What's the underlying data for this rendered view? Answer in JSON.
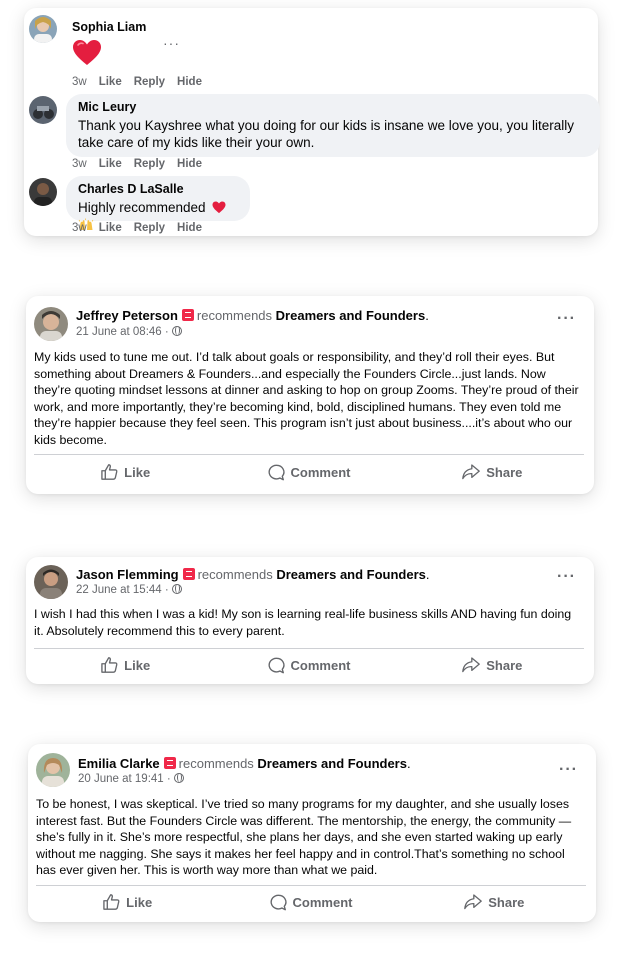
{
  "comments": [
    {
      "name": "Sophia Liam",
      "text": "",
      "time": "3w",
      "like": "Like",
      "reply": "Reply",
      "hide": "Hide",
      "more": "···"
    },
    {
      "name": "Mic Leury",
      "text": "Thank you Kayshree what you doing for our kids is insane we love you, you literally take care of my kids like their your own.",
      "time": "3w",
      "like": "Like",
      "reply": "Reply",
      "hide": "Hide"
    },
    {
      "name": "Charles D LaSalle",
      "text": "Highly recommended",
      "time": "3w",
      "like": "Like",
      "reply": "Reply",
      "hide": "Hide"
    }
  ],
  "posts": [
    {
      "author": "Jeffrey Peterson",
      "recommends": "recommends",
      "page": "Dreamers and Founders",
      "date": "21 June at 08:46 ·",
      "more": "···",
      "text": "My kids used to tune me out. I’d talk about goals or responsibility, and they’d roll their eyes. But something about Dreamers & Founders...and especially the Founders Circle...just lands. Now they’re quoting mindset lessons at dinner and asking to hop on group Zooms. They’re proud of their work, and more importantly, they’re becoming kind, bold, disciplined humans. They even told me they’re happier because they feel seen. This program isn’t just about business....it’s about who our kids become.",
      "like": "Like",
      "comment": "Comment",
      "share": "Share"
    },
    {
      "author": "Jason Flemming",
      "recommends": "recommends",
      "page": "Dreamers and Founders",
      "date": "22 June at 15:44 ·",
      "more": "···",
      "text": "I wish I had this when I was a kid! My son is learning real-life business skills AND having fun doing it. Absolutely recommend this to every parent.",
      "like": "Like",
      "comment": "Comment",
      "share": "Share"
    },
    {
      "author": "Emilia Clarke",
      "recommends": "recommends",
      "page": "Dreamers and Founders",
      "date": "20 June at 19:41 ·",
      "more": "···",
      "text": "To be honest, I was skeptical. I’ve tried so many programs for my daughter, and she usually loses interest fast. But the Founders Circle was different. The mentorship, the energy, the community — she’s fully in it. She’s more respectful, she plans her days, and she even started waking up early without me nagging. She says it makes her feel happy and in control.That’s something no school has ever given her. This is worth way more than what we paid.",
      "like": "Like",
      "comment": "Comment",
      "share": "Share"
    }
  ],
  "icons": {
    "heart": "heart-emoji",
    "hands": "raised-hands-emoji",
    "like": "thumbs-up-icon",
    "comment": "comment-bubble-icon",
    "share": "share-arrow-icon",
    "globe": "globe-icon"
  },
  "colors": {
    "heart": "#e41e3f",
    "recommend_badge": "#f02849",
    "secondary_text": "#65676b",
    "bubble_bg": "#f0f2f5"
  }
}
